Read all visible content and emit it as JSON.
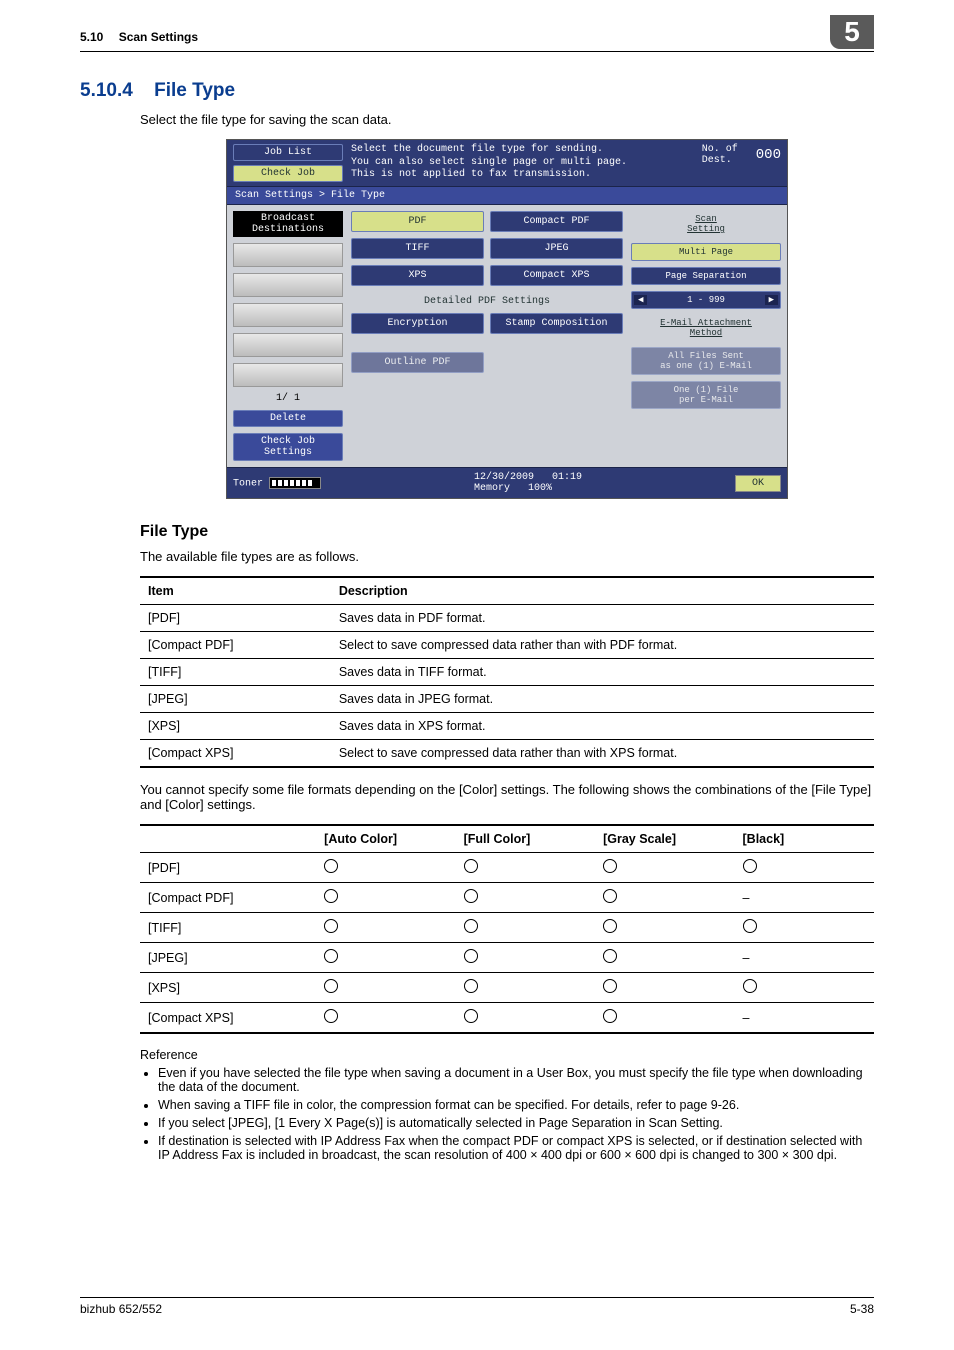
{
  "header": {
    "section_number": "5.10",
    "section_title": "Scan Settings",
    "chapter_badge": "5"
  },
  "title": {
    "number": "5.10.4",
    "text": "File Type"
  },
  "intro": "Select the file type for saving the scan data.",
  "mock": {
    "top_left_buttons": {
      "job_list": "Job List",
      "check_job": "Check Job"
    },
    "message": "Select the document file type for sending.\nYou can also select single page or multi page.\nThis is not applied to fax transmission.",
    "dest_count_label": "No. of\nDest.",
    "dest_count_value": "000",
    "breadcrumb": "Scan Settings > File Type",
    "sidebar": {
      "dest_label": "Broadcast\nDestinations",
      "page_indicator": "1/  1",
      "delete": "Delete",
      "check_settings": "Check Job\nSettings"
    },
    "options": {
      "pdf": "PDF",
      "compact_pdf": "Compact PDF",
      "tiff": "TIFF",
      "jpeg": "JPEG",
      "xps": "XPS",
      "compact_xps": "Compact XPS"
    },
    "detailed_header": "Detailed PDF Settings",
    "detailed": {
      "encryption": "Encryption",
      "stamp": "Stamp Composition",
      "outline": "Outline PDF"
    },
    "right": {
      "scan_setting": "Scan\nSetting",
      "multi_page": "Multi Page",
      "page_separation": "Page Separation",
      "spinner_value": "1  -  999",
      "attach_method": "E-Mail Attachment\nMethod",
      "all_files": "All Files Sent\nas one (1) E-Mail",
      "one_file": "One (1) File\nper E-Mail"
    },
    "bottom": {
      "toner_label": "Toner",
      "date": "12/30/2009",
      "time": "01:19",
      "memory_label": "Memory",
      "memory_value": "100%",
      "ok": "OK"
    }
  },
  "filetype_section": {
    "heading": "File Type",
    "lead": "The available file types are as follows.",
    "cols": {
      "item": "Item",
      "desc": "Description"
    },
    "rows": [
      {
        "item": "[PDF]",
        "desc": "Saves data in PDF format."
      },
      {
        "item": "[Compact PDF]",
        "desc": "Select to save compressed data rather than with PDF format."
      },
      {
        "item": "[TIFF]",
        "desc": "Saves data in TIFF format."
      },
      {
        "item": "[JPEG]",
        "desc": "Saves data in JPEG format."
      },
      {
        "item": "[XPS]",
        "desc": "Saves data in XPS format."
      },
      {
        "item": "[Compact XPS]",
        "desc": "Select to save compressed data rather than with XPS format."
      }
    ]
  },
  "combo_para": "You cannot specify some file formats depending on the [Color] settings. The following shows the combinations of the [File Type] and [Color] settings.",
  "combo_table": {
    "cols": {
      "blank": "",
      "auto": "[Auto Color]",
      "full": "[Full Color]",
      "gray": "[Gray Scale]",
      "black": "[Black]"
    },
    "rows": [
      {
        "item": "[PDF]",
        "auto": "o",
        "full": "o",
        "gray": "o",
        "black": "o"
      },
      {
        "item": "[Compact PDF]",
        "auto": "o",
        "full": "o",
        "gray": "o",
        "black": "-"
      },
      {
        "item": "[TIFF]",
        "auto": "o",
        "full": "o",
        "gray": "o",
        "black": "o"
      },
      {
        "item": "[JPEG]",
        "auto": "o",
        "full": "o",
        "gray": "o",
        "black": "-"
      },
      {
        "item": "[XPS]",
        "auto": "o",
        "full": "o",
        "gray": "o",
        "black": "o"
      },
      {
        "item": "[Compact XPS]",
        "auto": "o",
        "full": "o",
        "gray": "o",
        "black": "-"
      }
    ]
  },
  "reference": {
    "heading": "Reference",
    "items": [
      "Even if you have selected the file type when saving a document in a User Box, you must specify the file type when downloading the data of the document.",
      "When saving a TIFF file in color, the compression format can be specified. For details, refer to page 9-26.",
      "If you select [JPEG], [1 Every X Page(s)] is automatically selected in Page Separation in Scan Setting.",
      "If destination is selected with IP Address Fax when the compact PDF or compact XPS is selected, or if destination selected with IP Address Fax is included in broadcast, the scan resolution of 400 × 400 dpi or 600 × 600 dpi is changed to 300 × 300 dpi."
    ]
  },
  "footer": {
    "left": "bizhub 652/552",
    "right": "5-38"
  }
}
